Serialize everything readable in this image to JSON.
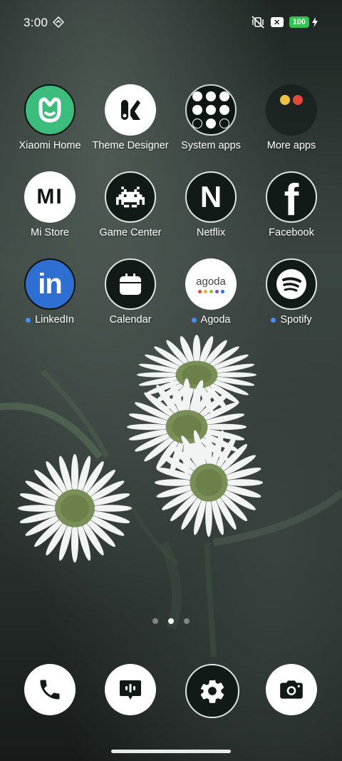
{
  "status_bar": {
    "time": "3:00",
    "battery": "100",
    "close_badge": "✕"
  },
  "apps": {
    "xiaomi_home": {
      "label": "Xiaomi Home",
      "icon": "xiaomi-home-icon"
    },
    "theme_designer": {
      "label": "Theme Designer",
      "icon": "theme-designer-icon"
    },
    "system_apps": {
      "label": "System apps",
      "icon": "folder-icon"
    },
    "more_apps": {
      "label": "More apps",
      "icon": "folder-icon"
    },
    "mi_store": {
      "label": "Mi Store",
      "icon": "mi-logo-icon",
      "logo_text": "MI"
    },
    "game_center": {
      "label": "Game Center",
      "icon": "space-invader-icon"
    },
    "netflix": {
      "label": "Netflix",
      "icon": "netflix-n-icon",
      "logo_text": "N"
    },
    "facebook": {
      "label": "Facebook",
      "icon": "facebook-f-icon",
      "logo_text": "f"
    },
    "linkedin": {
      "label": "LinkedIn",
      "icon": "linkedin-icon",
      "logo_text": "in",
      "new": true
    },
    "calendar": {
      "label": "Calendar",
      "icon": "calendar-icon"
    },
    "agoda": {
      "label": "Agoda",
      "icon": "agoda-icon",
      "logo_text": "agoda",
      "new": true
    },
    "spotify": {
      "label": "Spotify",
      "icon": "spotify-icon",
      "new": true
    }
  },
  "page_indicator": {
    "pages": 3,
    "current": 2
  },
  "dock": [
    "phone-icon",
    "messages-icon",
    "settings-icon",
    "camera-icon"
  ],
  "colors": {
    "xiaomi_home_green": "#3dbd7d",
    "linkedin_blue": "#2f6fd1",
    "new_dot_blue": "#4a8cf7",
    "battery_green": "#34c34e"
  }
}
